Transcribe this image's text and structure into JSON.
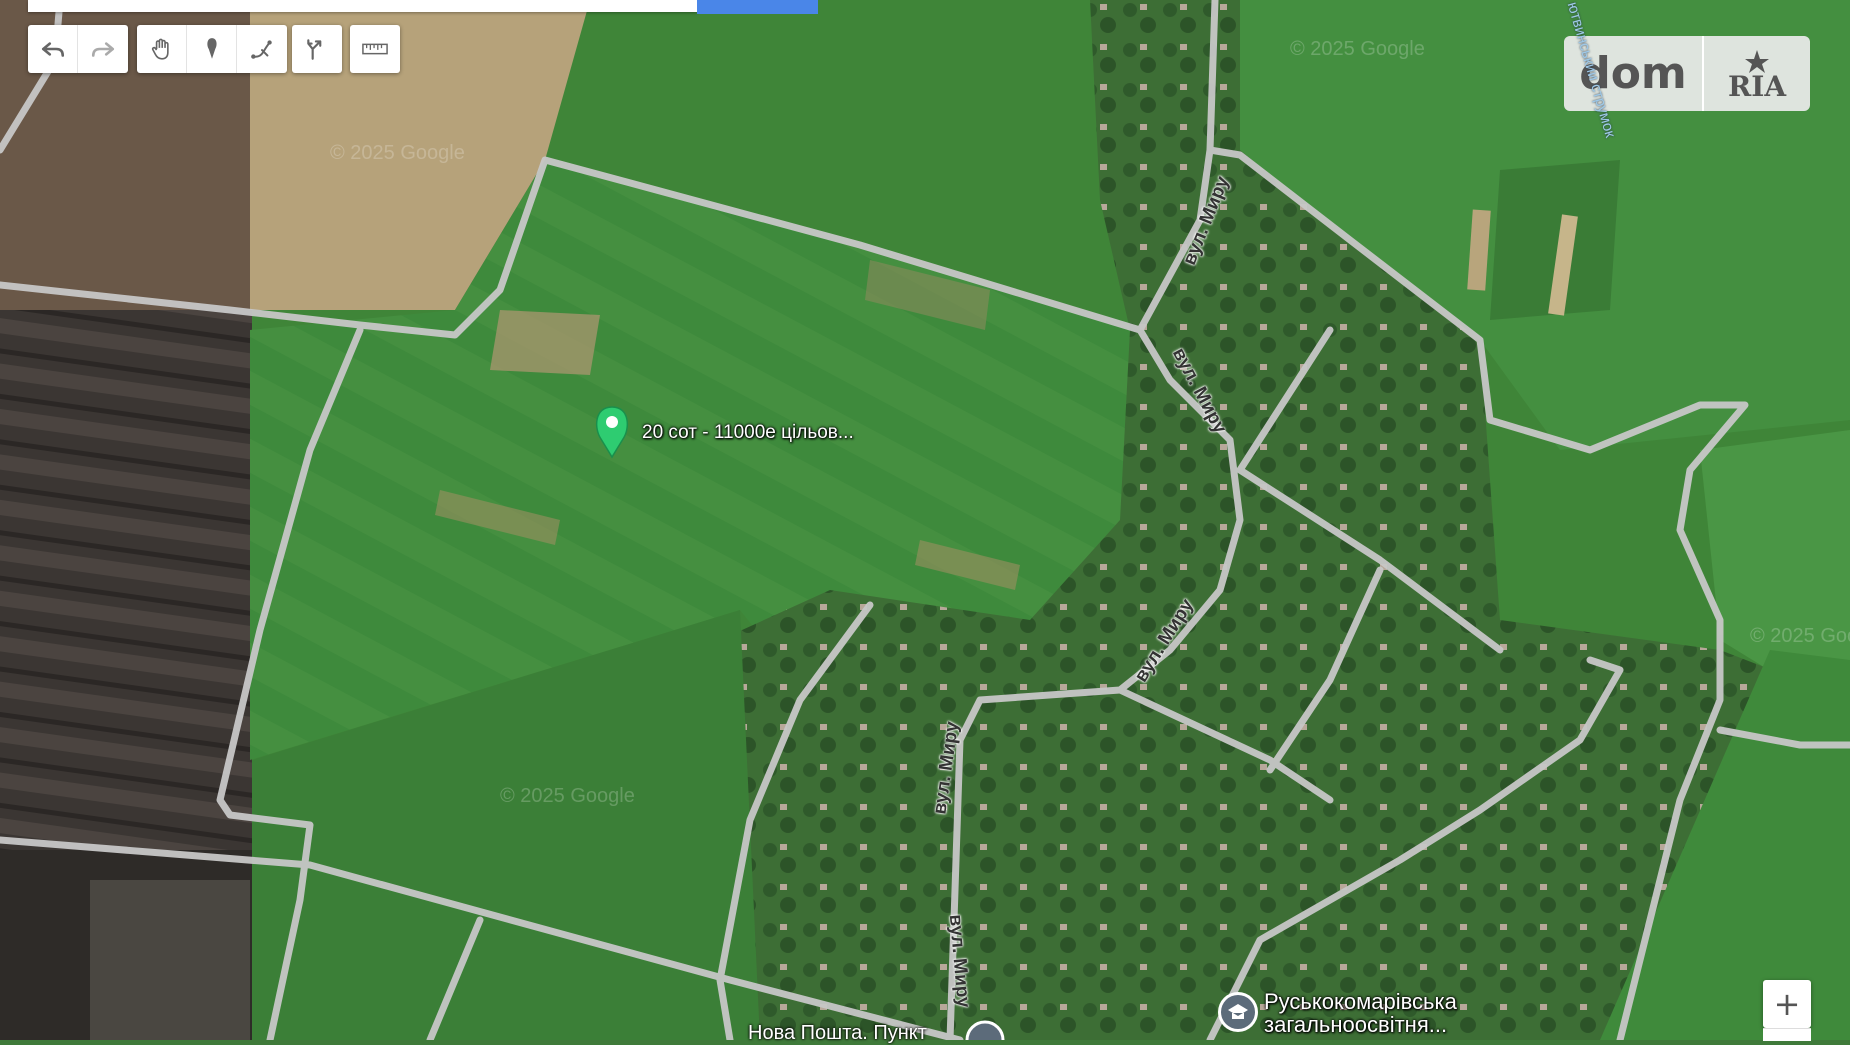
{
  "toolbar": {
    "buttons": [
      "undo",
      "redo",
      "pan",
      "add-marker",
      "draw-line",
      "draw-route",
      "measure-distance"
    ]
  },
  "logo": {
    "dom": "dom",
    "ria": "RIA"
  },
  "marker": {
    "label": "20 сот - 11000е цільов...",
    "color": "#2ecc71"
  },
  "streets": [
    {
      "label": "вул. Миру"
    },
    {
      "label": "вул. Миру"
    },
    {
      "label": "вул. Миру"
    },
    {
      "label": "вул. Миру"
    },
    {
      "label": "вул. Миру"
    }
  ],
  "stream": {
    "label": "ютвинськии струмок"
  },
  "pois": {
    "school": {
      "line1": "Руськокомарівська",
      "line2": "загальноосвітня..."
    },
    "post": {
      "label": "Нова Пошта. Пункт"
    }
  },
  "watermark": "© 2025 Google",
  "controls": {
    "zoom_in": "+"
  },
  "colors": {
    "search_button": "#4a86e8",
    "marker": "#2ecc71",
    "road": "#c9c9c9"
  }
}
